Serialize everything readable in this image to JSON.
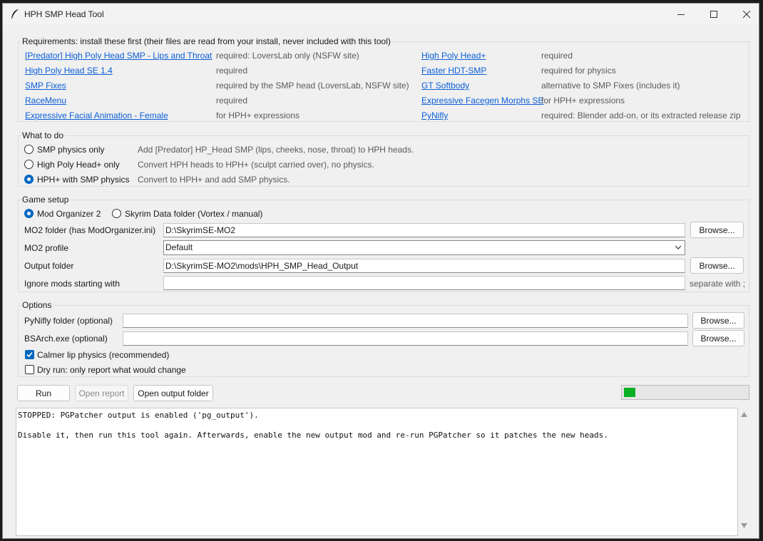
{
  "window": {
    "title": "HPH SMP Head Tool",
    "accent_color": "#0067c0",
    "link_color": "#0b5ed7"
  },
  "requirements": {
    "title": "Requirements: install these first (their files are read from your install, never included with this tool)",
    "left": [
      {
        "link": "[Predator] High Poly Head SMP - Lips and Throat",
        "note": "required: LoversLab only (NSFW site)"
      },
      {
        "link": "High Poly Head SE 1.4",
        "note": "required"
      },
      {
        "link": "SMP Fixes",
        "note": "required by the SMP head (LoversLab, NSFW site)"
      },
      {
        "link": "RaceMenu",
        "note": "required"
      },
      {
        "link": "Expressive Facial Animation - Female",
        "note": "for HPH+ expressions"
      }
    ],
    "right": [
      {
        "link": "High Poly Head+",
        "note": "required"
      },
      {
        "link": "Faster HDT-SMP",
        "note": "required for physics"
      },
      {
        "link": "GT Softbody",
        "note": "alternative to SMP Fixes (includes it)"
      },
      {
        "link": "Expressive Facegen Morphs SE",
        "note": "for HPH+ expressions"
      },
      {
        "link": "PyNifly",
        "note": "required: Blender add-on, or its extracted release zip"
      }
    ]
  },
  "what_to_do": {
    "title": "What to do",
    "options": [
      {
        "label": "SMP physics only",
        "desc": "Add [Predator] HP_Head SMP (lips, cheeks, nose, throat) to HPH heads.",
        "selected": false
      },
      {
        "label": "High Poly Head+ only",
        "desc": "Convert HPH heads to HPH+ (sculpt carried over), no physics.",
        "selected": false
      },
      {
        "label": "HPH+ with SMP physics",
        "desc": "Convert to HPH+ and add SMP physics.",
        "selected": true
      }
    ]
  },
  "game_setup": {
    "title": "Game setup",
    "mode_mo2": "Mod Organizer 2",
    "mode_vortex": "Skyrim Data folder (Vortex / manual)",
    "mo2_folder_label": "MO2 folder (has ModOrganizer.ini)",
    "mo2_folder_value": "D:\\SkyrimSE-MO2",
    "mo2_profile_label": "MO2 profile",
    "mo2_profile_value": "Default",
    "output_label": "Output folder",
    "output_value": "D:\\SkyrimSE-MO2\\mods\\HPH_SMP_Head_Output",
    "ignore_label": "Ignore mods starting with",
    "ignore_value": "",
    "ignore_hint": "separate with ;",
    "browse": "Browse..."
  },
  "options": {
    "title": "Options",
    "pynifly_label": "PyNifly folder (optional)",
    "pynifly_value": "",
    "bsarch_label": "BSArch.exe (optional)",
    "bsarch_value": "",
    "calmer_label": "Calmer lip physics (recommended)",
    "calmer_checked": true,
    "dryrun_label": "Dry run: only report what would change",
    "dryrun_checked": false,
    "browse": "Browse..."
  },
  "actions": {
    "run": "Run",
    "open_report": "Open report",
    "open_output": "Open output folder",
    "progress_fraction": 0.095,
    "progress_color": "#06b025"
  },
  "console": {
    "text": "STOPPED: PGPatcher output is enabled ('pg_output').\n\nDisable it, then run this tool again. Afterwards, enable the new output mod and re-run PGPatcher so it patches the new heads."
  }
}
